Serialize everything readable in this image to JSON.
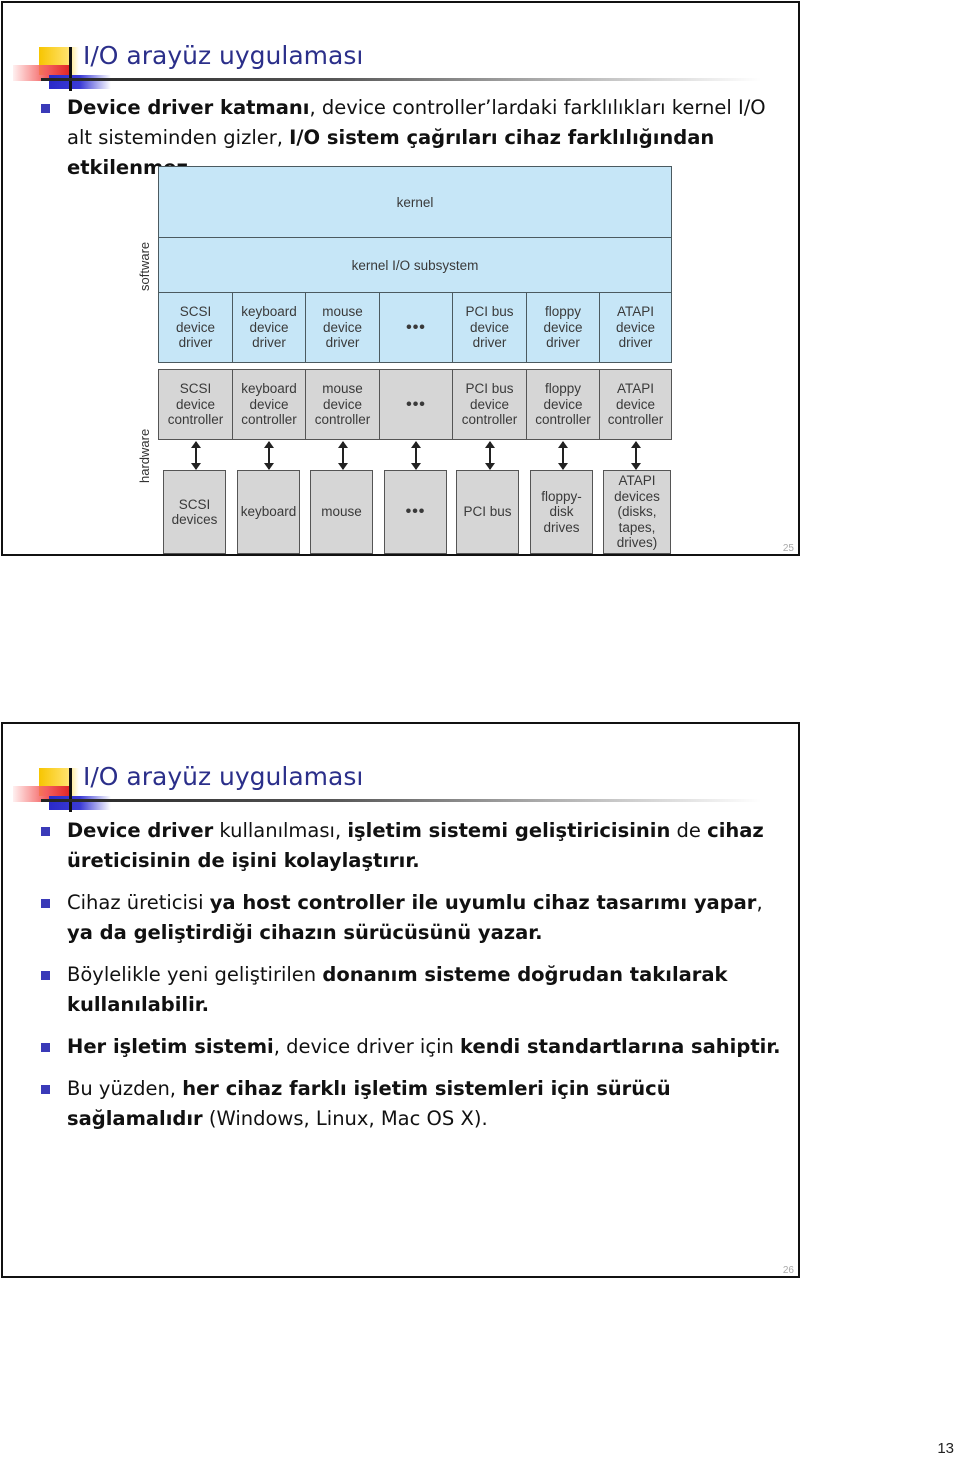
{
  "slide1": {
    "title": "I/O arayüz uygulaması",
    "bullets": [
      {
        "segments": [
          {
            "text": "Device driver katmanı",
            "bold": true
          },
          {
            "text": ", device controller’lardaki farklılıkları kernel I/O alt sisteminden gizler, ",
            "bold": false
          },
          {
            "text": "I/O sistem çağrıları cihaz farklılığından etkilenmez.",
            "bold": true
          }
        ]
      }
    ],
    "diagram": {
      "side_labels": {
        "software": "software",
        "hardware": "hardware"
      },
      "kernel": "kernel",
      "kernel_io_subsystem": "kernel I/O subsystem",
      "drivers": [
        "SCSI\ndevice\ndriver",
        "keyboard\ndevice\ndriver",
        "mouse\ndevice\ndriver",
        "•••",
        "PCI bus\ndevice\ndriver",
        "floppy\ndevice\ndriver",
        "ATAPI\ndevice\ndriver"
      ],
      "controllers": [
        "SCSI\ndevice\ncontroller",
        "keyboard\ndevice\ncontroller",
        "mouse\ndevice\ncontroller",
        "•••",
        "PCI bus\ndevice\ncontroller",
        "floppy\ndevice\ncontroller",
        "ATAPI\ndevice\ncontroller"
      ],
      "devices": [
        "SCSI\ndevices",
        "keyboard",
        "mouse",
        "•••",
        "PCI bus",
        "floppy-\ndisk\ndrives",
        "ATAPI\ndevices\n(disks,\ntapes,\ndrives)"
      ]
    },
    "page_number": "25"
  },
  "slide2": {
    "title": "I/O arayüz uygulaması",
    "bullets": [
      {
        "segments": [
          {
            "text": "Device driver",
            "bold": true
          },
          {
            "text": " kullanılması, ",
            "bold": false
          },
          {
            "text": "işletim sistemi geliştiricisinin",
            "bold": true
          },
          {
            "text": " de ",
            "bold": false
          },
          {
            "text": "cihaz üreticisinin de işini kolaylaştırır.",
            "bold": true
          }
        ]
      },
      {
        "segments": [
          {
            "text": "Cihaz üreticisi ",
            "bold": false
          },
          {
            "text": "ya host controller ile uyumlu cihaz tasarımı yapar",
            "bold": true
          },
          {
            "text": ", ",
            "bold": false
          },
          {
            "text": "ya da geliştirdiği cihazın sürücüsünü yazar.",
            "bold": true
          }
        ]
      },
      {
        "segments": [
          {
            "text": "Böylelikle yeni geliştirilen ",
            "bold": false
          },
          {
            "text": "donanım sisteme doğrudan takılarak kullanılabilir.",
            "bold": true
          }
        ]
      },
      {
        "segments": [
          {
            "text": "Her işletim sistemi",
            "bold": true
          },
          {
            "text": ", device driver için ",
            "bold": false
          },
          {
            "text": "kendi standartlarına sahiptir.",
            "bold": true
          }
        ]
      },
      {
        "segments": [
          {
            "text": "Bu yüzden, ",
            "bold": false
          },
          {
            "text": "her cihaz farklı işletim sistemleri için sürücü sağlamalıdır",
            "bold": true
          },
          {
            "text": " (Windows, Linux, Mac OS X).",
            "bold": false
          }
        ]
      }
    ],
    "page_number": "26"
  },
  "document_page_number": "13",
  "colors": {
    "title": "#2b2f8a",
    "bullet": "#3a3ab8",
    "software_fill": "#c6e6f7",
    "hardware_fill": "#d6d6d6"
  }
}
